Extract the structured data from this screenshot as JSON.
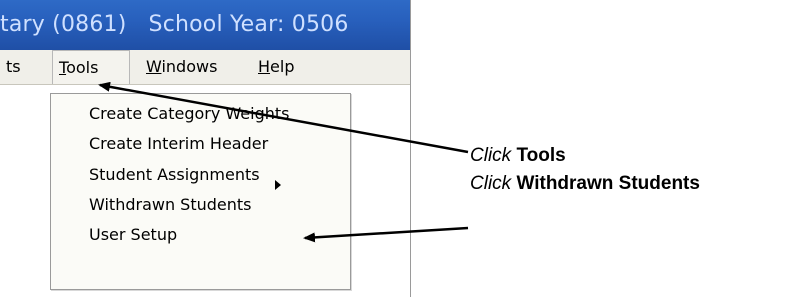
{
  "window": {
    "title_partial": "tary (0861)",
    "school_year": "School Year: 0506"
  },
  "menubar": {
    "items": [
      {
        "label": "ts",
        "underline": ""
      },
      {
        "label": "Tools",
        "underline": "T",
        "rest": "ools"
      },
      {
        "label": "Windows",
        "underline": "W",
        "rest": "indows"
      },
      {
        "label": "Help",
        "underline": "H",
        "rest": "elp"
      }
    ]
  },
  "tools_menu": {
    "items": [
      {
        "label": "Create Category Weights"
      },
      {
        "label": "Create Interim Header"
      },
      {
        "label": "Student Assignments",
        "has_submenu": true
      },
      {
        "label": "Withdrawn Students"
      },
      {
        "label": "User Setup"
      }
    ]
  },
  "annotations": [
    {
      "verb": "Click",
      "target": "Tools"
    },
    {
      "verb": "Click",
      "target": "Withdrawn Students"
    }
  ],
  "colors": {
    "titlebar": "#2860bd",
    "titlebar_text": "#cfe0ff",
    "menubar": "#f0efe9",
    "dropdown_bg": "#fbfbf7"
  },
  "icons": [
    "submenu-arrow-icon",
    "annotation-arrow-icon"
  ]
}
